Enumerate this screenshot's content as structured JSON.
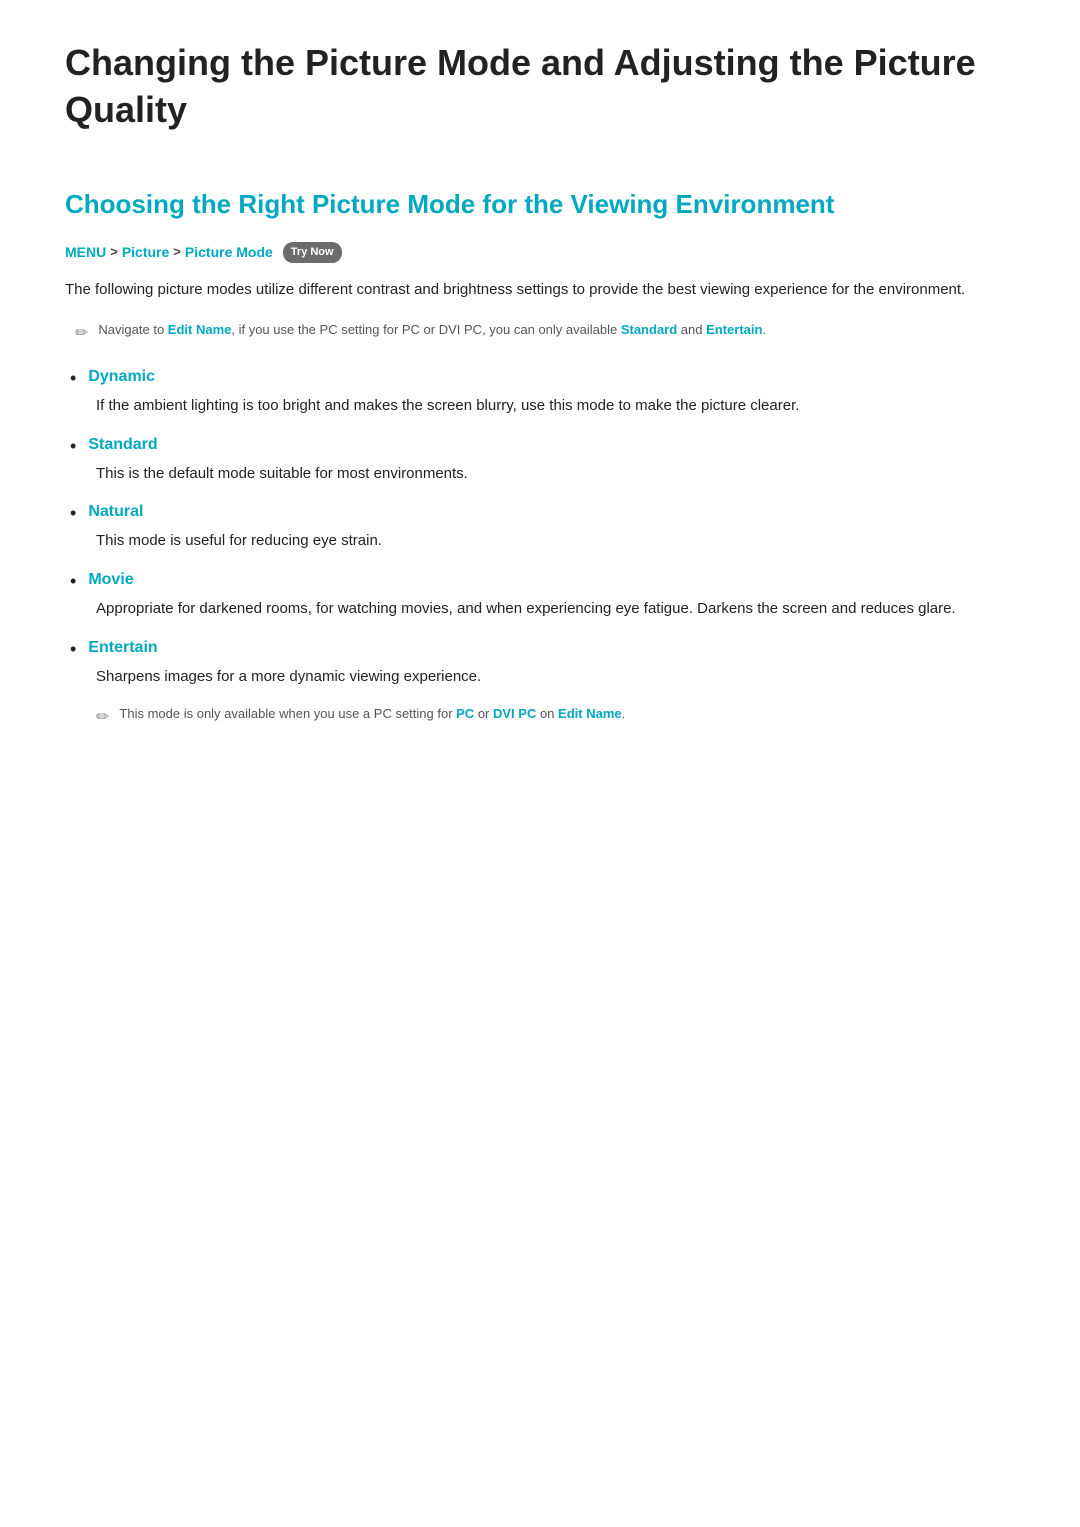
{
  "page": {
    "main_title": "Changing the Picture Mode and Adjusting the Picture Quality",
    "section_title": "Choosing the Right Picture Mode for the Viewing Environment",
    "breadcrumb": {
      "menu": "MENU",
      "separator1": ">",
      "picture": "Picture",
      "separator2": ">",
      "picture_mode": "Picture Mode",
      "try_now": "Try Now"
    },
    "intro_text": "The following picture modes utilize different contrast and brightness settings to provide the best viewing experience for the environment.",
    "note1": {
      "text_prefix": "Navigate to ",
      "edit_name": "Edit Name",
      "text_mid": ", if you use the PC setting for PC or DVI PC, you can only available ",
      "standard": "Standard",
      "text_and": " and ",
      "entertain": "Entertain",
      "text_end": "."
    },
    "list_items": [
      {
        "id": "dynamic",
        "title": "Dynamic",
        "description": "If the ambient lighting is too bright and makes the screen blurry, use this mode to make the picture clearer."
      },
      {
        "id": "standard",
        "title": "Standard",
        "description": "This is the default mode suitable for most environments."
      },
      {
        "id": "natural",
        "title": "Natural",
        "description": "This mode is useful for reducing eye strain."
      },
      {
        "id": "movie",
        "title": "Movie",
        "description": "Appropriate for darkened rooms, for watching movies, and when experiencing eye fatigue. Darkens the screen and reduces glare."
      },
      {
        "id": "entertain",
        "title": "Entertain",
        "description": "Sharpens images for a more dynamic viewing experience."
      }
    ],
    "sub_note": {
      "text_prefix": "This mode is only available when you use a PC setting for ",
      "pc": "PC",
      "text_mid": " or ",
      "dvi_pc": "DVI PC",
      "text_mid2": " on ",
      "edit_name": "Edit Name",
      "text_end": "."
    }
  }
}
